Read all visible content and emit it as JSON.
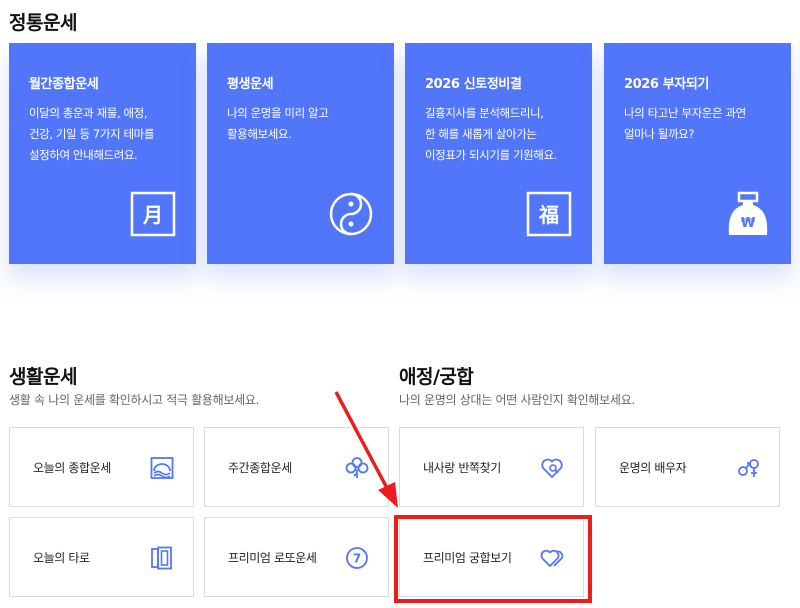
{
  "fortune": {
    "title": "정통운세",
    "cards": [
      {
        "title": "월간종합운세",
        "desc": "이달의 총운과 재물, 애정,\n건강, 기일 등 7가지 테마를\n설정하여 안내해드려요.",
        "icon": "calendar-month-icon",
        "glyph": "月"
      },
      {
        "title": "평생운세",
        "desc": "나의 운명을 미리 알고\n활용해보세요.",
        "icon": "yin-yang-icon"
      },
      {
        "title": "2026 신토정비결",
        "desc": "길흉지사를 분석해드리니,\n한 해를 새롭게 살아가는\n이정표가 되시기를 기원해요.",
        "icon": "fortune-bok-icon",
        "glyph": "福"
      },
      {
        "title": "2026 부자되기",
        "desc": "나의 타고난 부자운은 과연\n얼마나 될까요?",
        "icon": "money-bag-icon",
        "glyph": "₩"
      }
    ]
  },
  "life": {
    "title": "생활운세",
    "desc": "생활 속 나의 운세를 확인하시고 적극 활용해보세요.",
    "items": [
      {
        "label": "오늘의 종합운세",
        "icon": "sunrise-icon"
      },
      {
        "label": "주간종합운세",
        "icon": "clover-icon"
      },
      {
        "label": "오늘의 타로",
        "icon": "tarot-cards-icon"
      },
      {
        "label": "프리미엄 로또운세",
        "icon": "lotto-ball-icon",
        "glyph": "7"
      }
    ]
  },
  "love": {
    "title": "애정/궁합",
    "desc": "나의 운명의 상대는 어떤 사람인지 확인해보세요.",
    "items": [
      {
        "label": "내사랑 반쪽찾기",
        "icon": "heart-search-icon"
      },
      {
        "label": "운명의 배우자",
        "icon": "gender-symbols-icon"
      },
      {
        "label": "프리미엄 궁합보기",
        "icon": "double-heart-icon"
      }
    ]
  },
  "colors": {
    "accent": "#5276f9",
    "annotation": "#ee1d1d"
  }
}
